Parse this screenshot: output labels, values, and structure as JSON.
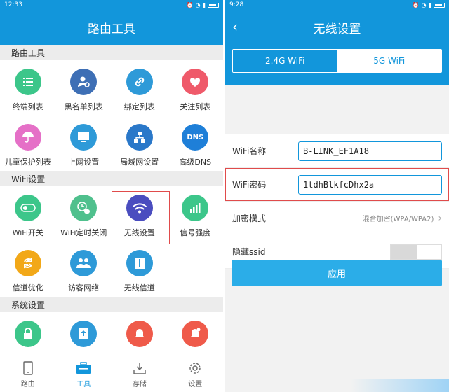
{
  "left": {
    "status": {
      "time": "12:33"
    },
    "title": "路由工具",
    "sections": [
      {
        "title": "路由工具",
        "items": [
          {
            "label": "终端列表",
            "icon": "list-icon",
            "color": "#3cc68a"
          },
          {
            "label": "黑名单列表",
            "icon": "user-block-icon",
            "color": "#3e6fb5"
          },
          {
            "label": "绑定列表",
            "icon": "link-icon",
            "color": "#2e9ad8"
          },
          {
            "label": "关注列表",
            "icon": "heart-icon",
            "color": "#ef5a6a"
          },
          {
            "label": "儿童保护列表",
            "icon": "umbrella-icon",
            "color": "#e570c7"
          },
          {
            "label": "上网设置",
            "icon": "monitor-icon",
            "color": "#2e9ad8"
          },
          {
            "label": "局域网设置",
            "icon": "network-icon",
            "color": "#2a78c9"
          },
          {
            "label": "高级DNS",
            "icon": "dns-icon",
            "color": "#1e7fd8",
            "text": "DNS"
          }
        ]
      },
      {
        "title": "WiFi设置",
        "items": [
          {
            "label": "WiFi开关",
            "icon": "toggle-icon",
            "color": "#3cc68a"
          },
          {
            "label": "WiFi定时关闭",
            "icon": "wifi-timer-icon",
            "color": "#4fc08d"
          },
          {
            "label": "无线设置",
            "icon": "wifi-icon",
            "color": "#4a4dbf"
          },
          {
            "label": "信号强度",
            "icon": "signal-icon",
            "color": "#3cc68a"
          },
          {
            "label": "信道优化",
            "icon": "channel-optimize-icon",
            "color": "#f2a818"
          },
          {
            "label": "访客网络",
            "icon": "guests-icon",
            "color": "#2e9ad8"
          },
          {
            "label": "无线信道",
            "icon": "channel-icon",
            "color": "#2e9ad8"
          }
        ]
      },
      {
        "title": "系统设置",
        "items": [
          {
            "label": "",
            "icon": "lock-icon",
            "color": "#3cc68a"
          },
          {
            "label": "",
            "icon": "upload-icon",
            "color": "#2e9ad8"
          },
          {
            "label": "",
            "icon": "bell-icon",
            "color": "#ef5a4a"
          },
          {
            "label": "",
            "icon": "bell-alert-icon",
            "color": "#ef5a4a"
          }
        ]
      }
    ],
    "nav": [
      {
        "label": "路由",
        "icon": "phone-icon"
      },
      {
        "label": "工具",
        "icon": "toolbox-icon",
        "active": true
      },
      {
        "label": "存储",
        "icon": "download-box-icon"
      },
      {
        "label": "设置",
        "icon": "gear-icon"
      }
    ]
  },
  "right": {
    "status": {
      "time": "9:28"
    },
    "title": "无线设置",
    "tabs": [
      "2.4G WiFi",
      "5G WiFi"
    ],
    "ssid_label": "WiFi名称",
    "ssid_value": "B-LINK_EF1A18",
    "pwd_label": "WiFi密码",
    "pwd_value": "1tdhBlkfcDhx2a",
    "enc_label": "加密模式",
    "enc_value": "混合加密(WPA/WPA2)",
    "hide_label": "隐藏ssid",
    "apply": "应用"
  }
}
